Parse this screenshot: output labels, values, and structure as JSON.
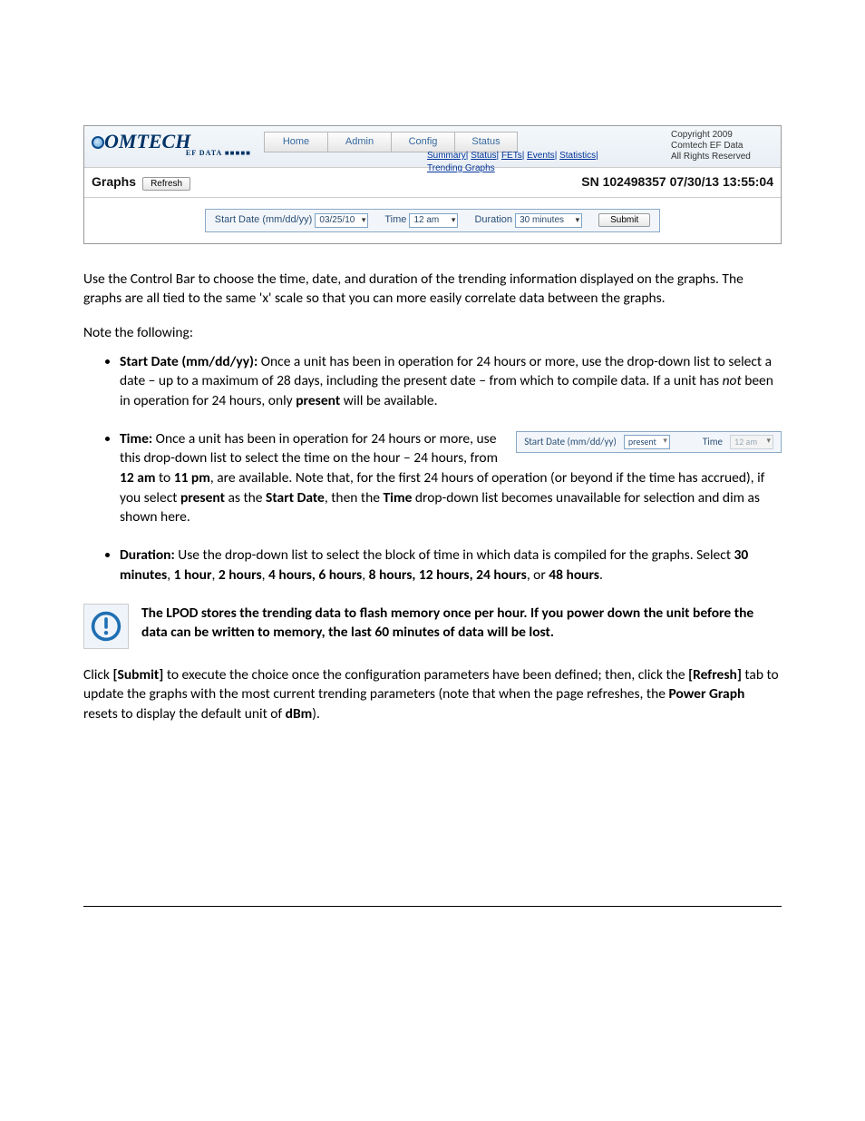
{
  "screenshot": {
    "logo": {
      "main": "OMTECH",
      "sub": "EF DATA ■■■■■"
    },
    "nav": [
      "Home",
      "Admin",
      "Config",
      "Status"
    ],
    "subnav": [
      "Summary",
      "Status",
      "FETs",
      "Events",
      "Statistics",
      "Trending Graphs"
    ],
    "copyright": [
      "Copyright 2009",
      "Comtech EF Data",
      "All Rights Reserved"
    ],
    "graphs_label": "Graphs",
    "refresh_label": "Refresh",
    "sn_text": "SN 102498357 07/30/13 13:55:04",
    "control": {
      "start_label": "Start Date (mm/dd/yy)",
      "start_value": "03/25/10",
      "time_label": "Time",
      "time_value": "12 am",
      "duration_label": "Duration",
      "duration_value": "30 minutes",
      "submit_label": "Submit"
    }
  },
  "body": {
    "p1": "Use the Control Bar to choose the time, date, and duration of the trending information displayed on the graphs. The graphs are all tied to the same 'x' scale so that you can more easily correlate data between the graphs.",
    "p2": "Note the following:",
    "li1_b": "Start Date (mm/dd/yy):",
    "li1_a": " Once a unit has been in operation for 24 hours or more, use the drop-down list to select a date – up to a maximum of 28 days, including the present date – from which to compile data. If a unit has ",
    "li1_i": "not",
    "li1_c": " been in operation for 24 hours, only ",
    "li1_d": "present",
    "li1_e": " will be available.",
    "li2_b": "Time:",
    "li2_a": " Once a unit has been in operation for 24 hours or more, use this drop-down list to select the time on the hour – 24 hours, from ",
    "li2_c": "12 am",
    "li2_d": " to ",
    "li2_e": "11 pm",
    "li2_f": ", are available. Note that, for the first 24 hours of operation (or beyond if the time has accrued), if you select ",
    "li2_g": "present",
    "li2_h": " as the ",
    "li2_i": "Start Date",
    "li2_j": ", then the ",
    "li2_k": "Time",
    "li2_l": " drop-down list becomes unavailable for selection and dim as shown here.",
    "li3_b": "Duration:",
    "li3_a": " Use the drop-down list to select the block of time in which data is compiled for the graphs. Select ",
    "li3_c": "30 minutes",
    "li3_d": "1 hour",
    "li3_e": "2 hours",
    "li3_f": "4 hours, 6 hours",
    "li3_g": "8 hours, 12 hours, 24 hours",
    "li3_h": "48 hours",
    "notice": "The LPOD stores the trending data to flash memory once per hour. If you power down the unit before the data can be written to memory, the last 60 minutes of data will be lost.",
    "p3_a": "Click ",
    "p3_b": "[Submit]",
    "p3_c": " to execute the choice once the configuration parameters have been defined; then, click the ",
    "p3_d": "[Refresh]",
    "p3_e": " tab to update the graphs with the most current trending parameters (note that when the page refreshes, the ",
    "p3_f": "Power Graph",
    "p3_g": " resets to display the default unit of ",
    "p3_h": "dBm",
    "p3_i": ")."
  },
  "inset": {
    "start_label": "Start Date (mm/dd/yy)",
    "start_value": "present",
    "time_label": "Time",
    "time_value": "12 am"
  }
}
